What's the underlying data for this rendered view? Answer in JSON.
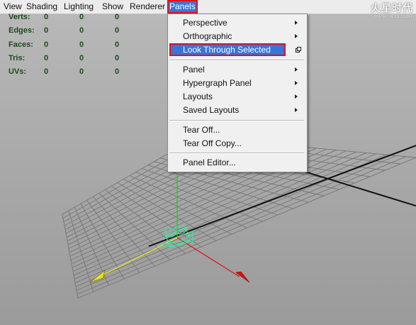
{
  "menubar": {
    "items": [
      "View",
      "Shading",
      "Lighting",
      "Show",
      "Renderer",
      "Panels"
    ],
    "active": "Panels"
  },
  "hud": {
    "rows": [
      {
        "label": "Verts:",
        "values": [
          "0",
          "0",
          "0"
        ]
      },
      {
        "label": "Edges:",
        "values": [
          "0",
          "0",
          "0"
        ]
      },
      {
        "label": "Faces:",
        "values": [
          "0",
          "0",
          "0"
        ]
      },
      {
        "label": "Tris:",
        "values": [
          "0",
          "0",
          "0"
        ]
      },
      {
        "label": "UVs:",
        "values": [
          "0",
          "0",
          "0"
        ]
      }
    ]
  },
  "panels_menu": {
    "items": [
      {
        "label": "Perspective",
        "submenu": true
      },
      {
        "label": "Orthographic",
        "submenu": true
      },
      {
        "label": "Look Through Selected",
        "highlighted": true,
        "option_box": true
      },
      {
        "label": "Panel",
        "submenu": true
      },
      {
        "label": "Hypergraph Panel",
        "submenu": true
      },
      {
        "label": "Layouts",
        "submenu": true
      },
      {
        "label": "Saved Layouts",
        "submenu": true
      },
      {
        "label": "Tear Off..."
      },
      {
        "label": "Tear Off Copy..."
      },
      {
        "label": "Panel Editor..."
      }
    ]
  },
  "watermark": {
    "title": "火星时代",
    "url": "www.hxsd.com"
  },
  "colors": {
    "menubar_bg": "#ececec",
    "highlight": "#3875d7",
    "annotation_outline": "#e0101a",
    "hud_text": "#1d4a1d",
    "axis_x": "#e01010",
    "axis_y": "#10c010",
    "axis_z": "#e0e020",
    "camera_wire": "#30f0a0"
  }
}
